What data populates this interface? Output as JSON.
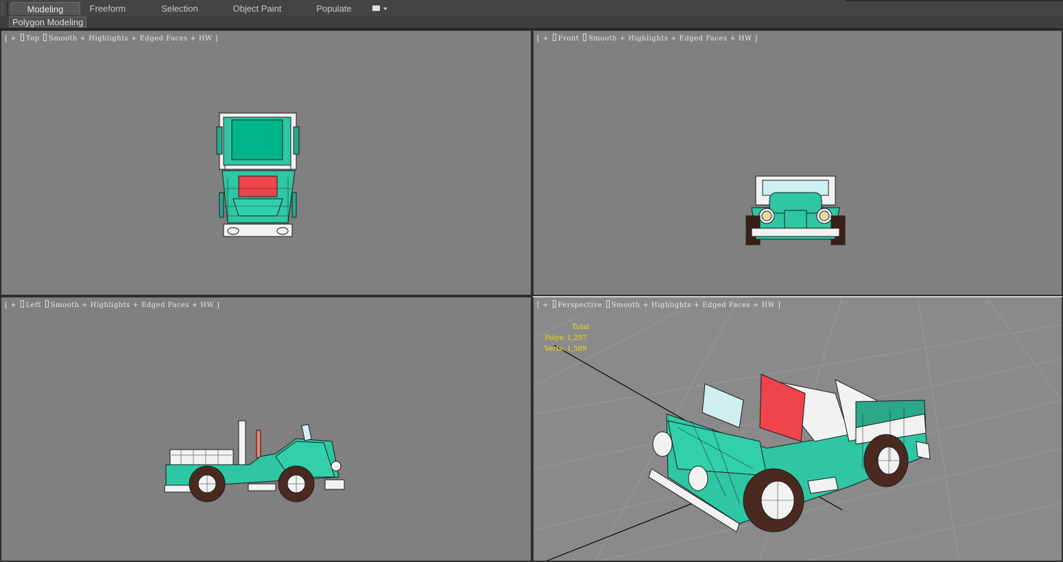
{
  "ribbon": {
    "tabs": [
      {
        "label": "Modeling",
        "active": true
      },
      {
        "label": "Freeform",
        "active": false
      },
      {
        "label": "Selection",
        "active": false
      },
      {
        "label": "Object Paint",
        "active": false
      },
      {
        "label": "Populate",
        "active": false
      }
    ],
    "panel_label": "Polygon Modeling"
  },
  "viewports": {
    "top": {
      "view": "Top",
      "shading": "Smooth + Highlights + Edged Faces + HW"
    },
    "front": {
      "view": "Front",
      "shading": "Smooth + Highlights + Edged Faces + HW"
    },
    "left": {
      "view": "Left",
      "shading": "Smooth + Highlights + Edged Faces + HW"
    },
    "perspective": {
      "view": "Perspective",
      "shading": "Smooth + Highlights + Edged Faces + HW"
    }
  },
  "stats": {
    "total_label": "Total",
    "polys_label": "Polys:",
    "polys_value": "1,297",
    "verts_label": "Verts:",
    "verts_value": "1,509"
  },
  "colors": {
    "viewport_bg": "#808080",
    "car_body": "#2fc6a3",
    "seat": "#f0434c",
    "trim": "#f2f2f2",
    "tire": "#4a2a20",
    "stats_text": "#f2e600"
  }
}
